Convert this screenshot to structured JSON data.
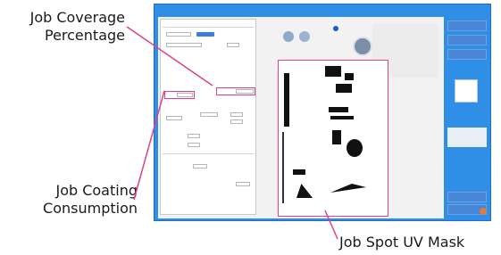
{
  "callouts": {
    "coverage_line1": "Job Coverage",
    "coverage_line2": "Percentage",
    "coating_line1": "Job Coating",
    "coating_line2": "Consumption",
    "mask": "Job Spot UV Mask"
  },
  "colors": {
    "callout_line": "#e0408a",
    "window_frame": "#2f8fe6"
  },
  "icons": [
    "preview-circle-icon",
    "settings-circle-icon",
    "thumbnail-icon",
    "close-icon"
  ]
}
